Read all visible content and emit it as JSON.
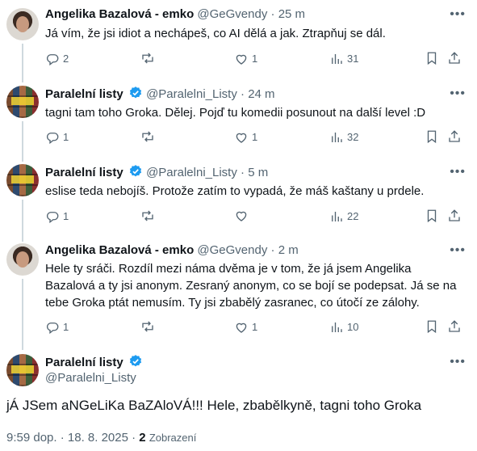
{
  "colors": {
    "verified": "#1d9bf0",
    "muted": "#536471",
    "text": "#0f1419",
    "thread_line": "#cfd9de"
  },
  "tweets": [
    {
      "name": "Angelika Bazalová - emko",
      "handle": "@GeGvendy",
      "sep": "·",
      "time": "25 m",
      "verified": false,
      "text": "Já vím, že jsi idiot a nechápeš, co AI dělá a jak.  Ztrapňuj se dál.",
      "replies": "2",
      "retweets": "",
      "likes": "1",
      "views": "31"
    },
    {
      "name": "Paralelní listy",
      "handle": "@Paralelni_Listy",
      "sep": "·",
      "time": "24 m",
      "verified": true,
      "text": "tagni tam toho Groka. Dělej. Pojď tu komedii posunout na další level :D",
      "replies": "1",
      "retweets": "",
      "likes": "1",
      "views": "32"
    },
    {
      "name": "Paralelní listy",
      "handle": "@Paralelni_Listy",
      "sep": "·",
      "time": "5 m",
      "verified": true,
      "text": "eslise teda nebojíš. Protože zatím to vypadá, že máš kaštany u prdele.",
      "replies": "1",
      "retweets": "",
      "likes": "",
      "views": "22"
    },
    {
      "name": "Angelika Bazalová - emko",
      "handle": "@GeGvendy",
      "sep": "·",
      "time": "2 m",
      "verified": false,
      "text": "Hele ty sráči. Rozdíl mezi náma dvěma je v tom, že já jsem Angelika Bazalová a ty jsi anonym. Zesraný anonym, co se bojí se podepsat. Já se na tebe Groka ptát nemusím.  Ty jsi zbabělý zasranec, co útočí ze zálohy.",
      "replies": "1",
      "retweets": "",
      "likes": "1",
      "views": "10"
    }
  ],
  "main_tweet": {
    "name": "Paralelní listy",
    "handle": "@Paralelni_Listy",
    "text": "jÁ JSem aNGeLiKa BaZAloVÁ!!! Hele, zbabělkyně, tagni toho Groka",
    "timestamp": "9:59 dop. · 18. 8. 2025 ·",
    "views_count": "2",
    "views_label": "Zobrazení"
  },
  "icons": [
    "more-icon",
    "reply-icon",
    "retweet-icon",
    "like-icon",
    "views-icon",
    "bookmark-icon",
    "share-icon",
    "verified-icon"
  ]
}
